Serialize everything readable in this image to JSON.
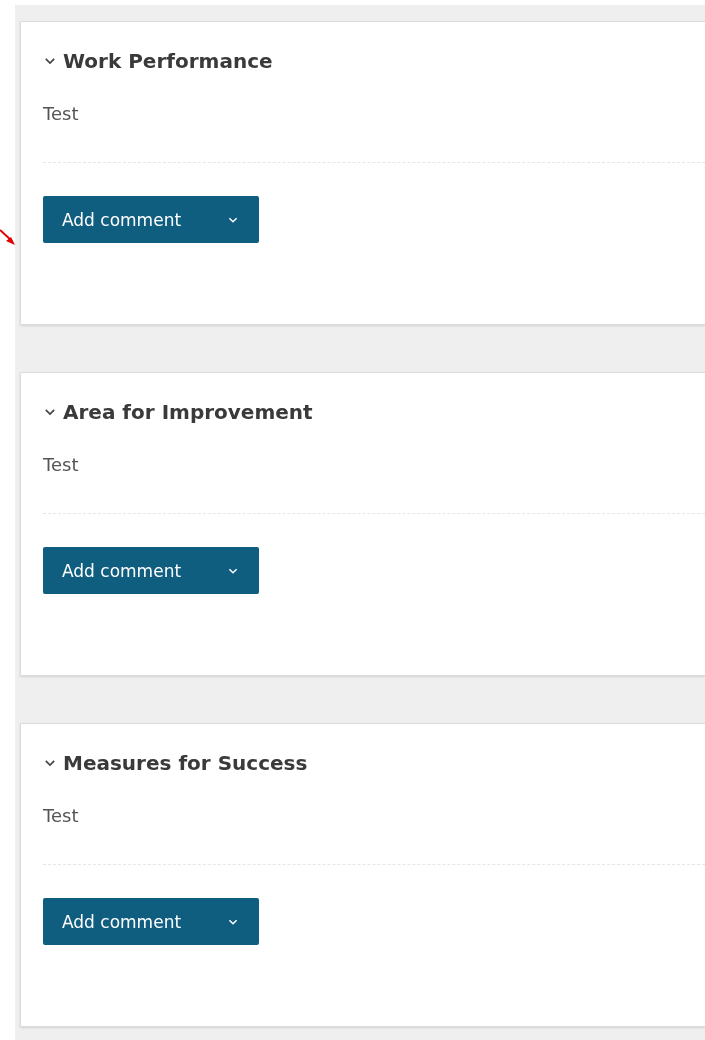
{
  "sections": [
    {
      "title": "Work Performance",
      "expanded": true,
      "text": "Test",
      "button": "Add comment"
    },
    {
      "title": "Area for Improvement",
      "expanded": true,
      "text": "Test",
      "button": "Add comment"
    },
    {
      "title": "Measures for Success",
      "expanded": true,
      "text": "Test",
      "button": "Add comment"
    }
  ]
}
